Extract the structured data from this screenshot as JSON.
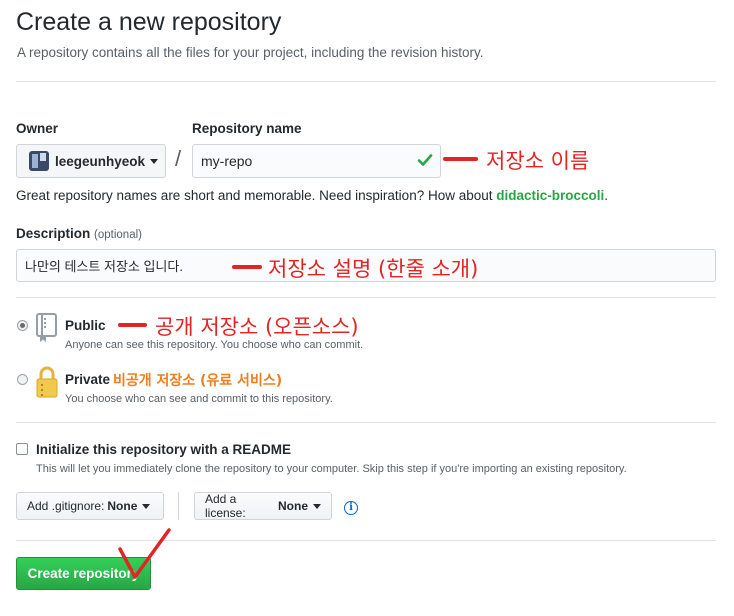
{
  "header": {
    "title": "Create a new repository",
    "subtitle": "A repository contains all the files for your project, including the revision history."
  },
  "owner": {
    "label": "Owner",
    "value": "leegeunhyeok"
  },
  "repo": {
    "label": "Repository name",
    "value": "my-repo",
    "slash": "/"
  },
  "hint": {
    "text": "Great repository names are short and memorable. Need inspiration? How about ",
    "suggestion": "didactic-broccoli",
    "end": "."
  },
  "description": {
    "label": "Description",
    "optional": "(optional)",
    "value": "나만의 테스트 저장소 입니다."
  },
  "visibility": {
    "public": {
      "title": "Public",
      "note": "Anyone can see this repository. You choose who can commit.",
      "checked": true
    },
    "private": {
      "title": "Private",
      "note": "You choose who can see and commit to this repository.",
      "checked": false
    }
  },
  "readme": {
    "title": "Initialize this repository with a README",
    "note": "This will let you immediately clone the repository to your computer. Skip this step if you're importing an existing repository."
  },
  "gitignore": {
    "prefix": "Add .gitignore:",
    "value": "None"
  },
  "license": {
    "prefix": "Add a license:",
    "value": "None"
  },
  "info_icon": "i",
  "submit": {
    "label": "Create repository"
  },
  "annotations": {
    "repo_name": "저장소 이름",
    "description": "저장소 설명 (한줄 소개)",
    "public": "공개 저장소 (오픈소스)",
    "private": "비공개 저장소 (유료 서비스)"
  },
  "colors": {
    "annotation_red": "#e32424",
    "annotation_orange": "#f07d1e",
    "button_green": "#28a745",
    "suggestion_green": "#28a745",
    "link_blue": "#0366d6"
  },
  "icons": {
    "valid": "check-icon",
    "public": "repo-book-icon",
    "private": "lock-icon",
    "info": "info-icon"
  }
}
